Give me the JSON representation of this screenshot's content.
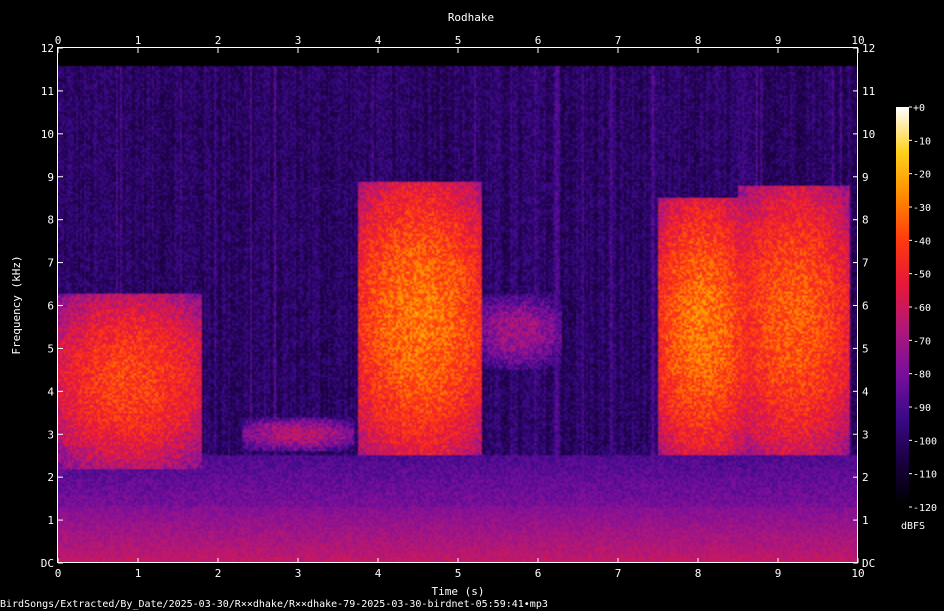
{
  "chart_data": {
    "type": "heatmap",
    "title": "Rodhake",
    "xlabel": "Time (s)",
    "ylabel": "Frequency (kHz)",
    "xlim": [
      0,
      10
    ],
    "ylim": [
      0,
      12
    ],
    "x_ticks": [
      "0",
      "1",
      "2",
      "3",
      "4",
      "5",
      "6",
      "7",
      "8",
      "9",
      "10"
    ],
    "y_ticks": [
      "DC",
      "1",
      "2",
      "3",
      "4",
      "5",
      "6",
      "7",
      "8",
      "9",
      "10",
      "11",
      "12"
    ],
    "colorbar": {
      "label": "dBFS",
      "range": [
        -120,
        0
      ],
      "ticks": [
        "+0",
        "-10",
        "-20",
        "-30",
        "-40",
        "-50",
        "-60",
        "-70",
        "-80",
        "-90",
        "-100",
        "-110",
        "-120"
      ]
    },
    "events": [
      {
        "t_start": 0.0,
        "t_end": 1.8,
        "f_low": 2.2,
        "f_high": 6.3,
        "peak_dBFS": -40
      },
      {
        "t_start": 2.3,
        "t_end": 3.7,
        "f_low": 2.6,
        "f_high": 3.4,
        "peak_dBFS": -65
      },
      {
        "t_start": 3.75,
        "t_end": 5.3,
        "f_low": 2.5,
        "f_high": 8.9,
        "peak_dBFS": -30
      },
      {
        "t_start": 5.2,
        "t_end": 6.3,
        "f_low": 4.5,
        "f_high": 6.3,
        "peak_dBFS": -70
      },
      {
        "t_start": 7.5,
        "t_end": 8.6,
        "f_low": 2.5,
        "f_high": 8.5,
        "peak_dBFS": -30
      },
      {
        "t_start": 8.5,
        "t_end": 9.9,
        "f_low": 2.5,
        "f_high": 8.8,
        "peak_dBFS": -35
      }
    ]
  },
  "footer": {
    "filename": "BirdSongs/Extracted/By_Date/2025-03-30/R××dhake/R××dhake-79-2025-03-30-birdnet-05:59:41•mp3"
  },
  "colors": {
    "background": "#000000",
    "axis": "#ffffff",
    "colormap": [
      "#000000",
      "#1a0040",
      "#3c0a8a",
      "#7a0f9c",
      "#b0187a",
      "#e8183a",
      "#ff3a10",
      "#ff8a00",
      "#ffd21c",
      "#ffffff"
    ]
  }
}
